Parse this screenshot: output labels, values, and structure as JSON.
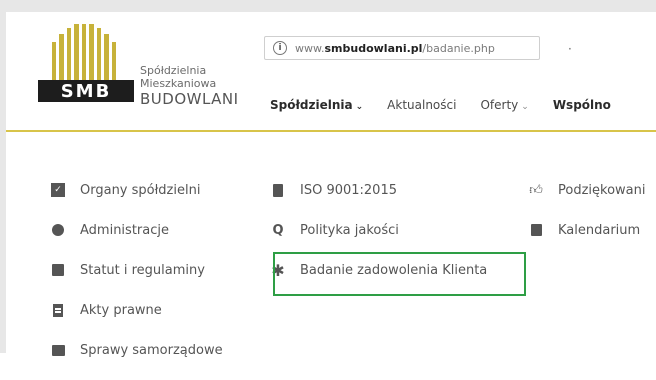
{
  "brand": {
    "logo_text": "SMB",
    "line1": "Spółdzielnia",
    "line2": "Mieszkaniowa",
    "line3": "BUDOWLANI"
  },
  "browser": {
    "info_icon": "info-icon",
    "url_prefix": "www.",
    "url_domain": "smbudowlani.pl",
    "url_path": "/badanie.php"
  },
  "nav": {
    "items": [
      {
        "label": "Spółdzielnia",
        "chevron": "⌄"
      },
      {
        "label": "Aktualności"
      },
      {
        "label": "Oferty",
        "chevron": "⌄"
      },
      {
        "label": "Wspólno"
      }
    ]
  },
  "menu": {
    "left": [
      {
        "label": "Organy spółdzielni",
        "icon": "checkbox-icon"
      },
      {
        "label": "Administracje",
        "icon": "circle-icon"
      },
      {
        "label": "Statut i regulaminy",
        "icon": "square-icon"
      },
      {
        "label": "Akty prawne",
        "icon": "document-icon"
      },
      {
        "label": "Sprawy samorządowe",
        "icon": "newspaper-icon"
      }
    ],
    "middle": [
      {
        "label": "ISO 9001:2015",
        "icon": "trash-icon"
      },
      {
        "label": "Polityka jakości",
        "icon": "search-icon"
      },
      {
        "label": "Badanie zadowolenia Klienta",
        "icon": "asterisk-icon"
      }
    ],
    "right": [
      {
        "label": "Podziękowani",
        "icon": "thumbs-up-icon"
      },
      {
        "label": "Kalendarium",
        "icon": "calendar-icon"
      }
    ]
  },
  "colors": {
    "accent_line": "#d8c44a",
    "highlight_border": "#2e9e45",
    "logo_bars": "#c7b23a",
    "logo_base": "#1d1d1d"
  }
}
